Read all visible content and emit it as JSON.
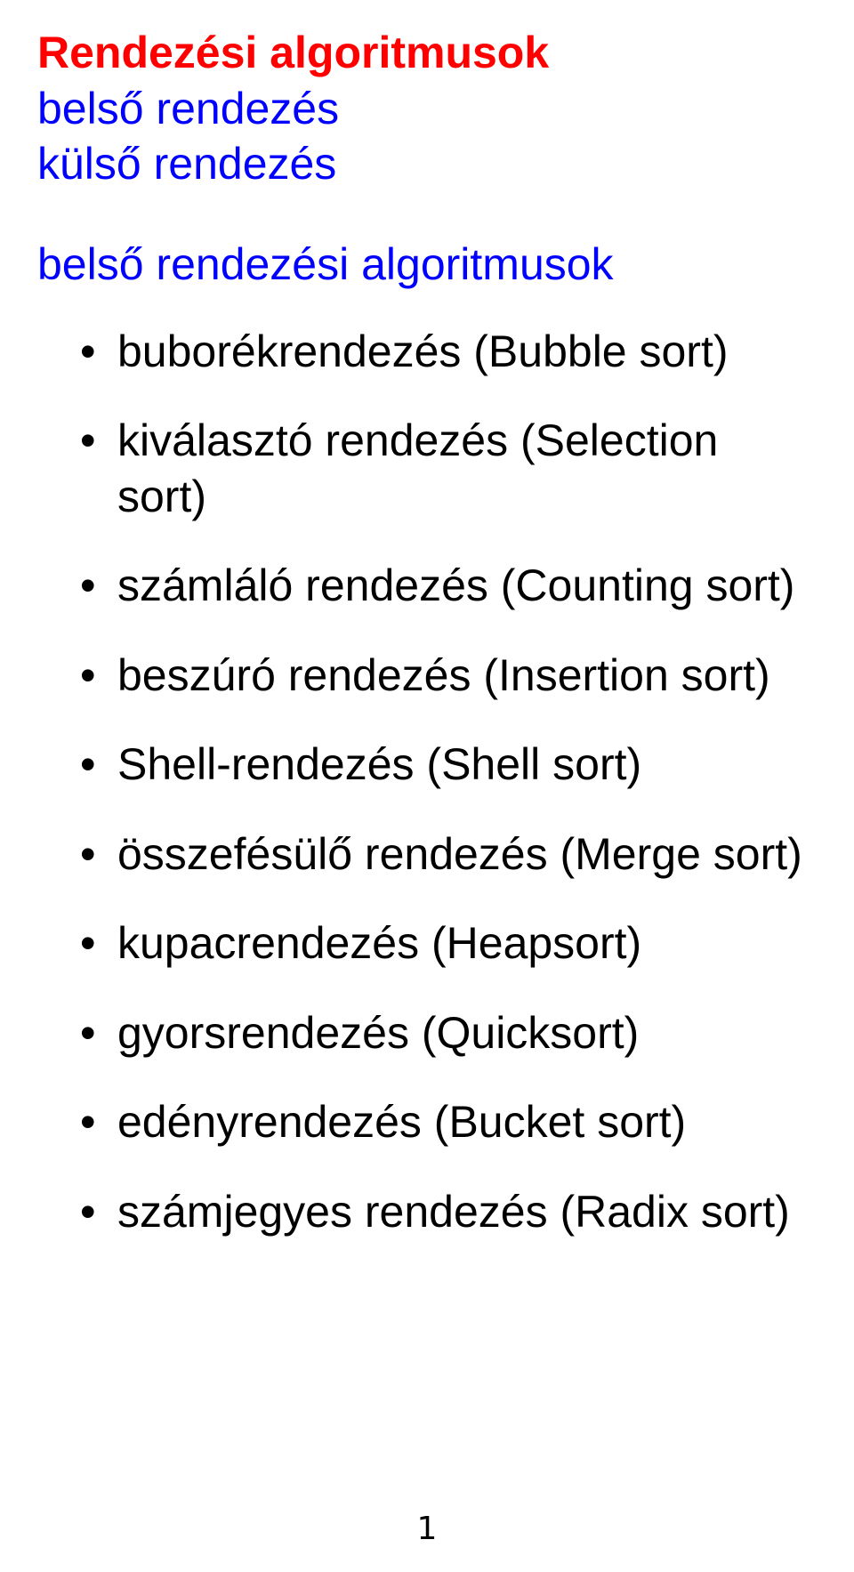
{
  "title_red": "Rendezési algoritmusok",
  "category_lines": [
    "belső rendezés",
    "külső rendezés"
  ],
  "section_heading": "belső rendezési algoritmusok",
  "bullet_char": "•",
  "algorithms": [
    "buborékrendezés (Bubble sort)",
    "kiválasztó rendezés (Selection sort)",
    "számláló rendezés (Counting sort)",
    "beszúró rendezés (Insertion sort)",
    "Shell-rendezés (Shell sort)",
    "összefésülő rendezés (Merge sort)",
    "kupacrendezés (Heapsort)",
    "gyorsrendezés (Quicksort)",
    "edényrendezés (Bucket sort)",
    "számjegyes rendezés (Radix sort)"
  ],
  "page_number": "1"
}
